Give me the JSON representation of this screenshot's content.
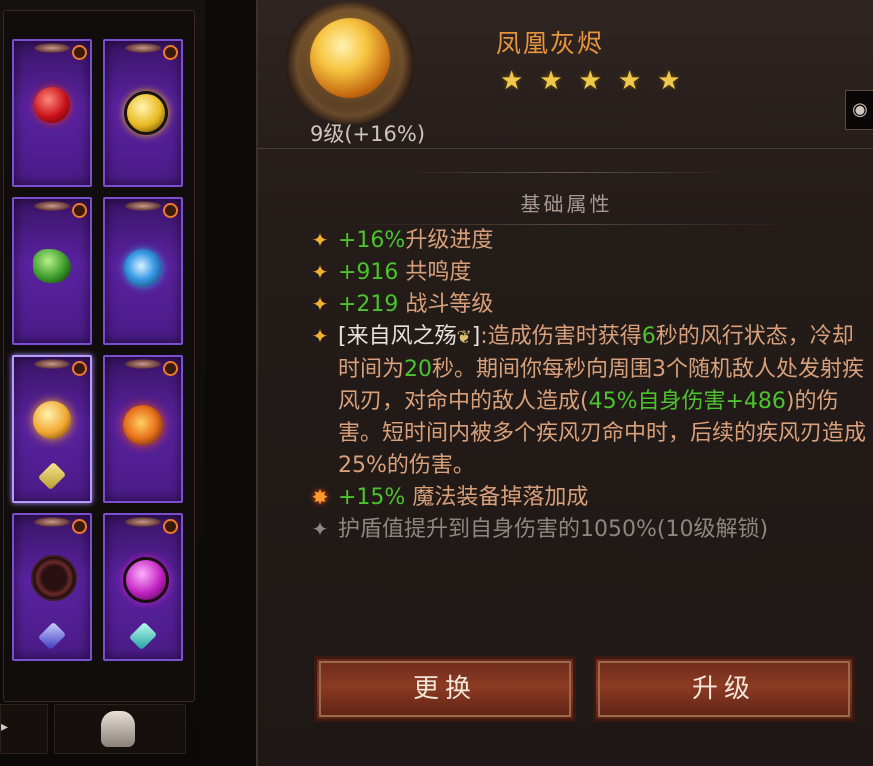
{
  "gem": {
    "name": "凤凰灰烬",
    "stars": [
      "★",
      "★",
      "★",
      "★",
      "★"
    ],
    "level_text": "9级(+16%)"
  },
  "section_title": "基础属性",
  "attributes": [
    {
      "value": "+16%",
      "text": "升级进度"
    },
    {
      "value": "+916",
      "text": " 共鸣度"
    },
    {
      "value": "+219",
      "text": " 战斗等级"
    }
  ],
  "effect": {
    "source": "[来自风之殇",
    "icon": "wind-leaf-icon",
    "after_icon": "]",
    "t1": ":造成伤害时获得",
    "n1": "6",
    "t2": "秒的风行状态，冷却时间为",
    "n2": "20",
    "t3": "秒。期间你每秒向周围3个随机敌人处发射疾风刃，对命中的敌人造成(",
    "n3": "45%自身伤害+486",
    "t4": ")的伤害。短时间内被多个疾风刃命中时，后续的疾风刃造成25%的伤害。"
  },
  "bonus": {
    "value": "+15%",
    "text": " 魔法装备掉落加成"
  },
  "locked": {
    "text": "护盾值提升到自身伤害的1050%(10级解锁)"
  },
  "buttons": {
    "replace": "更换",
    "upgrade": "升级"
  },
  "gem_cards": [
    {
      "gem": "red-gem-icon",
      "color": "#d8231c"
    },
    {
      "gem": "gold-orb-gem-icon",
      "color": "#e8b820"
    },
    {
      "gem": "green-gem-icon",
      "color": "#3a9a2a"
    },
    {
      "gem": "blue-swirl-gem-icon",
      "color": "#3a9ae8"
    },
    {
      "gem": "phoenix-ash-gem-icon",
      "color": "#f0a830",
      "selected": true
    },
    {
      "gem": "fire-gem-icon",
      "color": "#e8701c"
    },
    {
      "gem": "dark-ring-gem-icon",
      "color": "#6a2a2a"
    },
    {
      "gem": "magenta-orb-gem-icon",
      "color": "#c020c0"
    }
  ]
}
